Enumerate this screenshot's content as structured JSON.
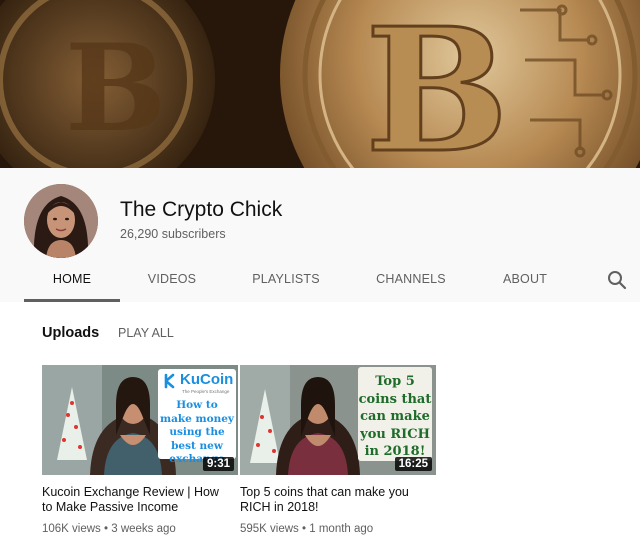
{
  "channel": {
    "name": "The Crypto Chick",
    "subscribers": "26,290 subscribers"
  },
  "tabs": [
    {
      "label": "HOME",
      "active": true
    },
    {
      "label": "VIDEOS",
      "active": false
    },
    {
      "label": "PLAYLISTS",
      "active": false
    },
    {
      "label": "CHANNELS",
      "active": false
    },
    {
      "label": "ABOUT",
      "active": false
    }
  ],
  "uploads": {
    "title": "Uploads",
    "play_all": "PLAY ALL"
  },
  "videos": [
    {
      "title": "Kucoin Exchange Review | How to Make Passive Income",
      "views": "106K views",
      "age": "3 weeks ago",
      "duration": "9:31",
      "thumb_brand": "KuCoin",
      "thumb_brand_sub": "The People's Exchange",
      "thumb_text": "How to make money using the best new exchange"
    },
    {
      "title": "Top 5 coins that can make you RICH in 2018!",
      "views": "595K views",
      "age": "1 month ago",
      "duration": "16:25",
      "thumb_text": "Top 5 coins that can make you RICH in 2018!"
    }
  ],
  "colors": {
    "header_bg": "#f9f9f9",
    "text_secondary": "#606060",
    "kucoin_blue": "#1a8fe0",
    "thumb_green": "#1f6b2a"
  }
}
